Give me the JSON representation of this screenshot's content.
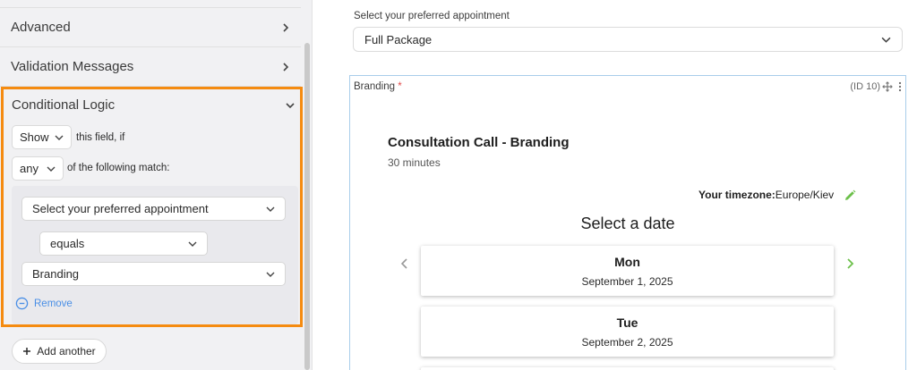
{
  "sidebar": {
    "sections": [
      {
        "label": "Advanced"
      },
      {
        "label": "Validation Messages"
      }
    ],
    "conditional_logic": {
      "title": "Conditional Logic",
      "action": "Show",
      "action_suffix": "this field, if",
      "match": "any",
      "match_suffix": "of the following match:",
      "rule": {
        "field": "Select your preferred appointment",
        "operator": "equals",
        "value": "Branding",
        "remove_label": "Remove"
      },
      "add_another_label": "Add another"
    }
  },
  "form": {
    "appointment_field": {
      "label": "Select your preferred appointment",
      "value": "Full Package"
    },
    "branding_field": {
      "label": "Branding",
      "required_mark": "*",
      "id_text": "(ID 10)",
      "title": "Consultation Call - Branding",
      "duration": "30 minutes",
      "timezone_label": "Your timezone:",
      "timezone_value": "Europe/Kiev",
      "select_date_heading": "Select a date",
      "days": [
        {
          "name": "Mon",
          "date": "September 1, 2025"
        },
        {
          "name": "Tue",
          "date": "September 2, 2025"
        }
      ]
    }
  },
  "colors": {
    "highlight_border": "#f58b10",
    "accent_green": "#6cc04a",
    "link_blue": "#4a8fe6",
    "frame_blue": "#a9cdea"
  },
  "icons": {
    "section_chevron": "chevron-right-icon",
    "expanded_chevron": "chevron-down-icon",
    "remove": "minus-circle-icon",
    "add": "plus-icon",
    "move": "move-icon",
    "more": "more-vertical-icon",
    "edit": "pencil-icon",
    "prev": "chevron-left-icon",
    "next": "chevron-right-icon"
  }
}
